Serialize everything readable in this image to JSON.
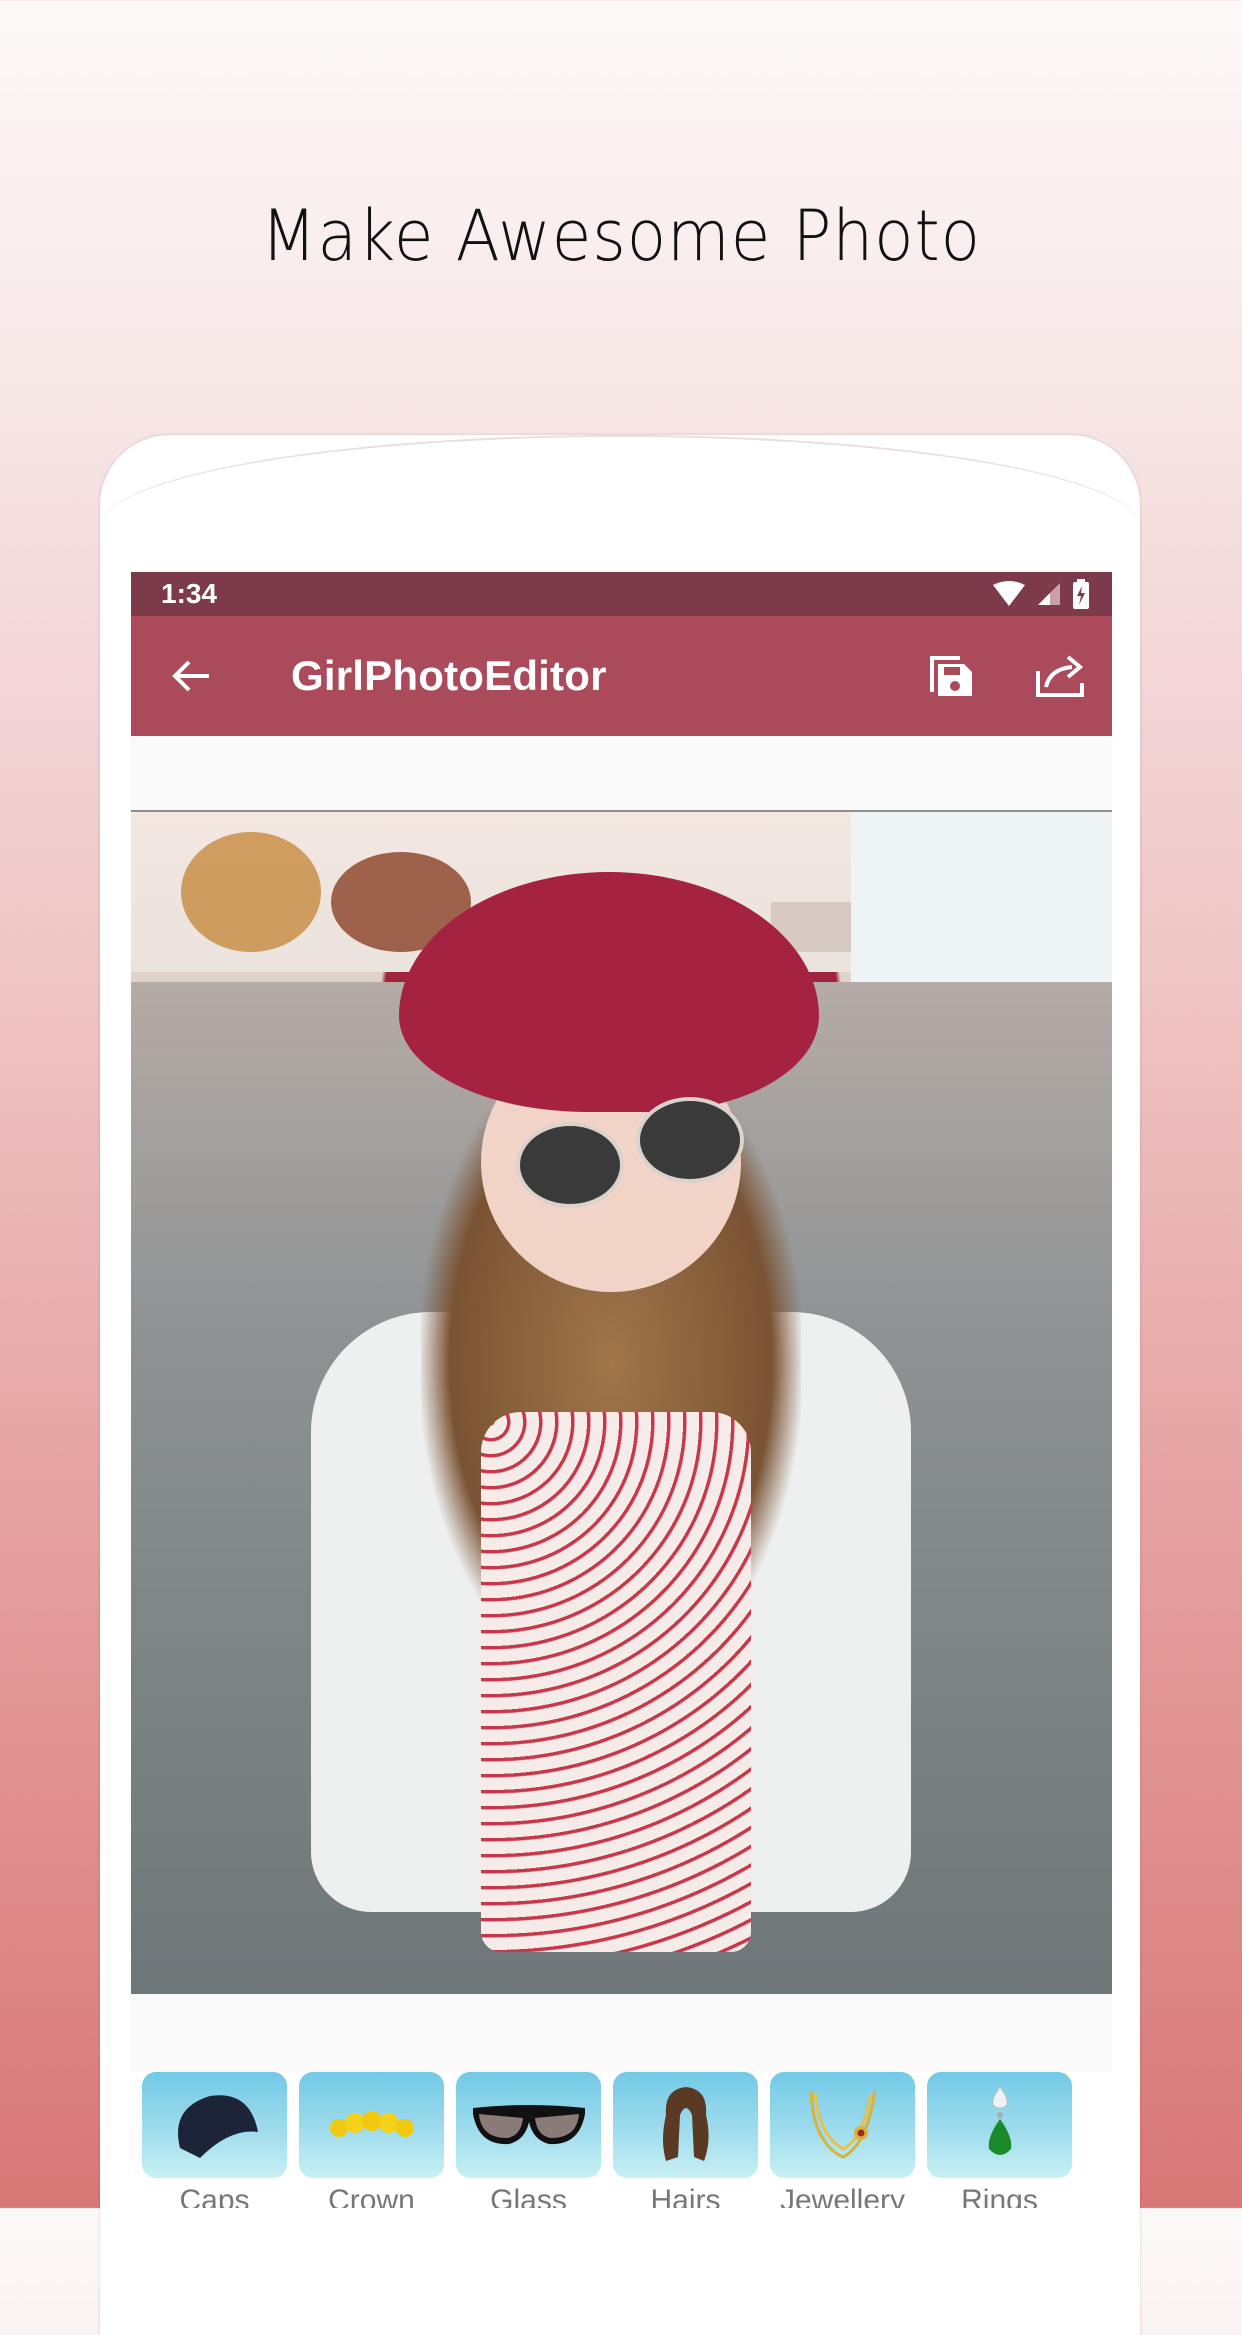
{
  "promo": {
    "headline": "Make Awesome Photo"
  },
  "status_bar": {
    "time": "1:34",
    "icons": [
      "wifi-icon",
      "signal-icon",
      "battery-charging-icon"
    ]
  },
  "app_bar": {
    "title": "GirlPhotoEditor",
    "back_icon": "arrow-left-icon",
    "actions": [
      {
        "name": "save",
        "icon": "save-icon"
      },
      {
        "name": "share",
        "icon": "share-icon"
      }
    ]
  },
  "photo": {
    "description": "Girl in red corduroy cap and sunglasses on a suburban street"
  },
  "stickers": {
    "items": [
      {
        "label": "Caps",
        "icon": "cap-icon"
      },
      {
        "label": "Crown",
        "icon": "flower-crown-icon"
      },
      {
        "label": "Glass",
        "icon": "sunglasses-icon"
      },
      {
        "label": "Hairs",
        "icon": "wig-icon"
      },
      {
        "label": "Jewellery",
        "icon": "necklace-icon"
      },
      {
        "label": "Rings",
        "icon": "gem-drop-icon"
      }
    ]
  },
  "colors": {
    "status_bar": "#7c3a4a",
    "app_bar": "#aa4a5a",
    "sticker_tile_top": "#72c9e6",
    "sticker_tile_bottom": "#c8f0f4",
    "label": "#777777"
  }
}
